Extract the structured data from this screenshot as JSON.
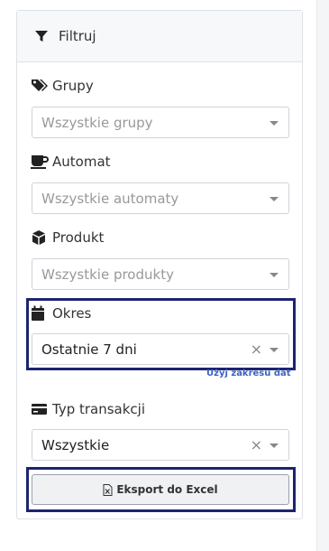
{
  "header": {
    "title": "Filtruj",
    "icon": "filter-icon"
  },
  "filters": {
    "groups": {
      "label": "Grupy",
      "icon": "tags-icon",
      "placeholder": "Wszystkie grupy"
    },
    "machine": {
      "label": "Automat",
      "icon": "coffee-cup-icon",
      "placeholder": "Wszystkie automaty"
    },
    "product": {
      "label": "Produkt",
      "icon": "box-icon",
      "placeholder": "Wszystkie produkty"
    },
    "period": {
      "label": "Okres",
      "icon": "calendar-icon",
      "value": "Ostatnie 7 dni",
      "clear": "×",
      "range_link": "Użyj zakresu dat"
    },
    "transaction": {
      "label": "Typ transakcji",
      "icon": "credit-card-icon",
      "value": "Wszystkie",
      "clear": "×"
    }
  },
  "export": {
    "label": "Eksport do Excel",
    "icon": "excel-file-icon"
  },
  "colors": {
    "highlight": "#1c2471",
    "link": "#3b63c4",
    "header_bg": "#f7f8fa"
  }
}
